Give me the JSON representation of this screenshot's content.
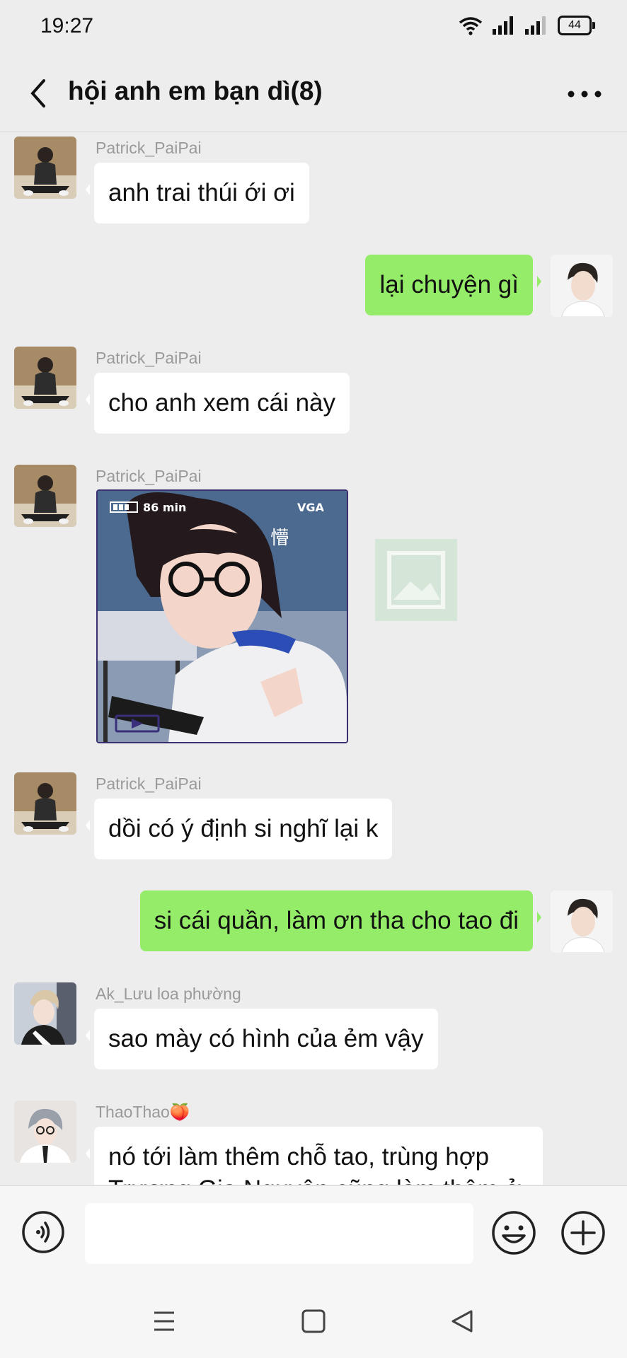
{
  "status": {
    "time": "19:27",
    "battery": "44"
  },
  "header": {
    "title": "hội anh em bạn dì(8)"
  },
  "messages": {
    "m1": {
      "sender": "Patrick_PaiPai",
      "text": "anh trai thúi ới ơi"
    },
    "m2": {
      "text": "lại chuyện gì"
    },
    "m3": {
      "sender": "Patrick_PaiPai",
      "text": "cho anh xem cái này"
    },
    "m4": {
      "sender": "Patrick_PaiPai",
      "photo_overlay": {
        "duration": "86 min",
        "quality": "VGA",
        "char": "懵"
      }
    },
    "m5": {
      "sender": "Patrick_PaiPai",
      "text": "dồi có ý định si nghĩ lại k"
    },
    "m6": {
      "text": "si cái quần, làm ơn tha cho tao đi"
    },
    "m7": {
      "sender": "Ak_Lưu loa phường",
      "text": "sao mày có hình của ẻm vậy"
    },
    "m8": {
      "sender": "ThaoThao🍑",
      "text": "nó tới làm thêm chỗ tao, trùng hợp Trương Gia Nguyên cũng làm thêm ở"
    }
  },
  "input": {
    "placeholder": ""
  },
  "icons": {
    "back": "chevron-left-icon",
    "more": "more-dots-icon",
    "voice": "voice-icon",
    "emoji": "emoji-icon",
    "plus": "plus-icon",
    "wifi": "wifi-icon",
    "signal": "signal-icon"
  },
  "colors": {
    "background": "#ededed",
    "outgoing_bubble": "#95ec69",
    "incoming_bubble": "#ffffff",
    "sender_name": "#9a9a9a"
  }
}
